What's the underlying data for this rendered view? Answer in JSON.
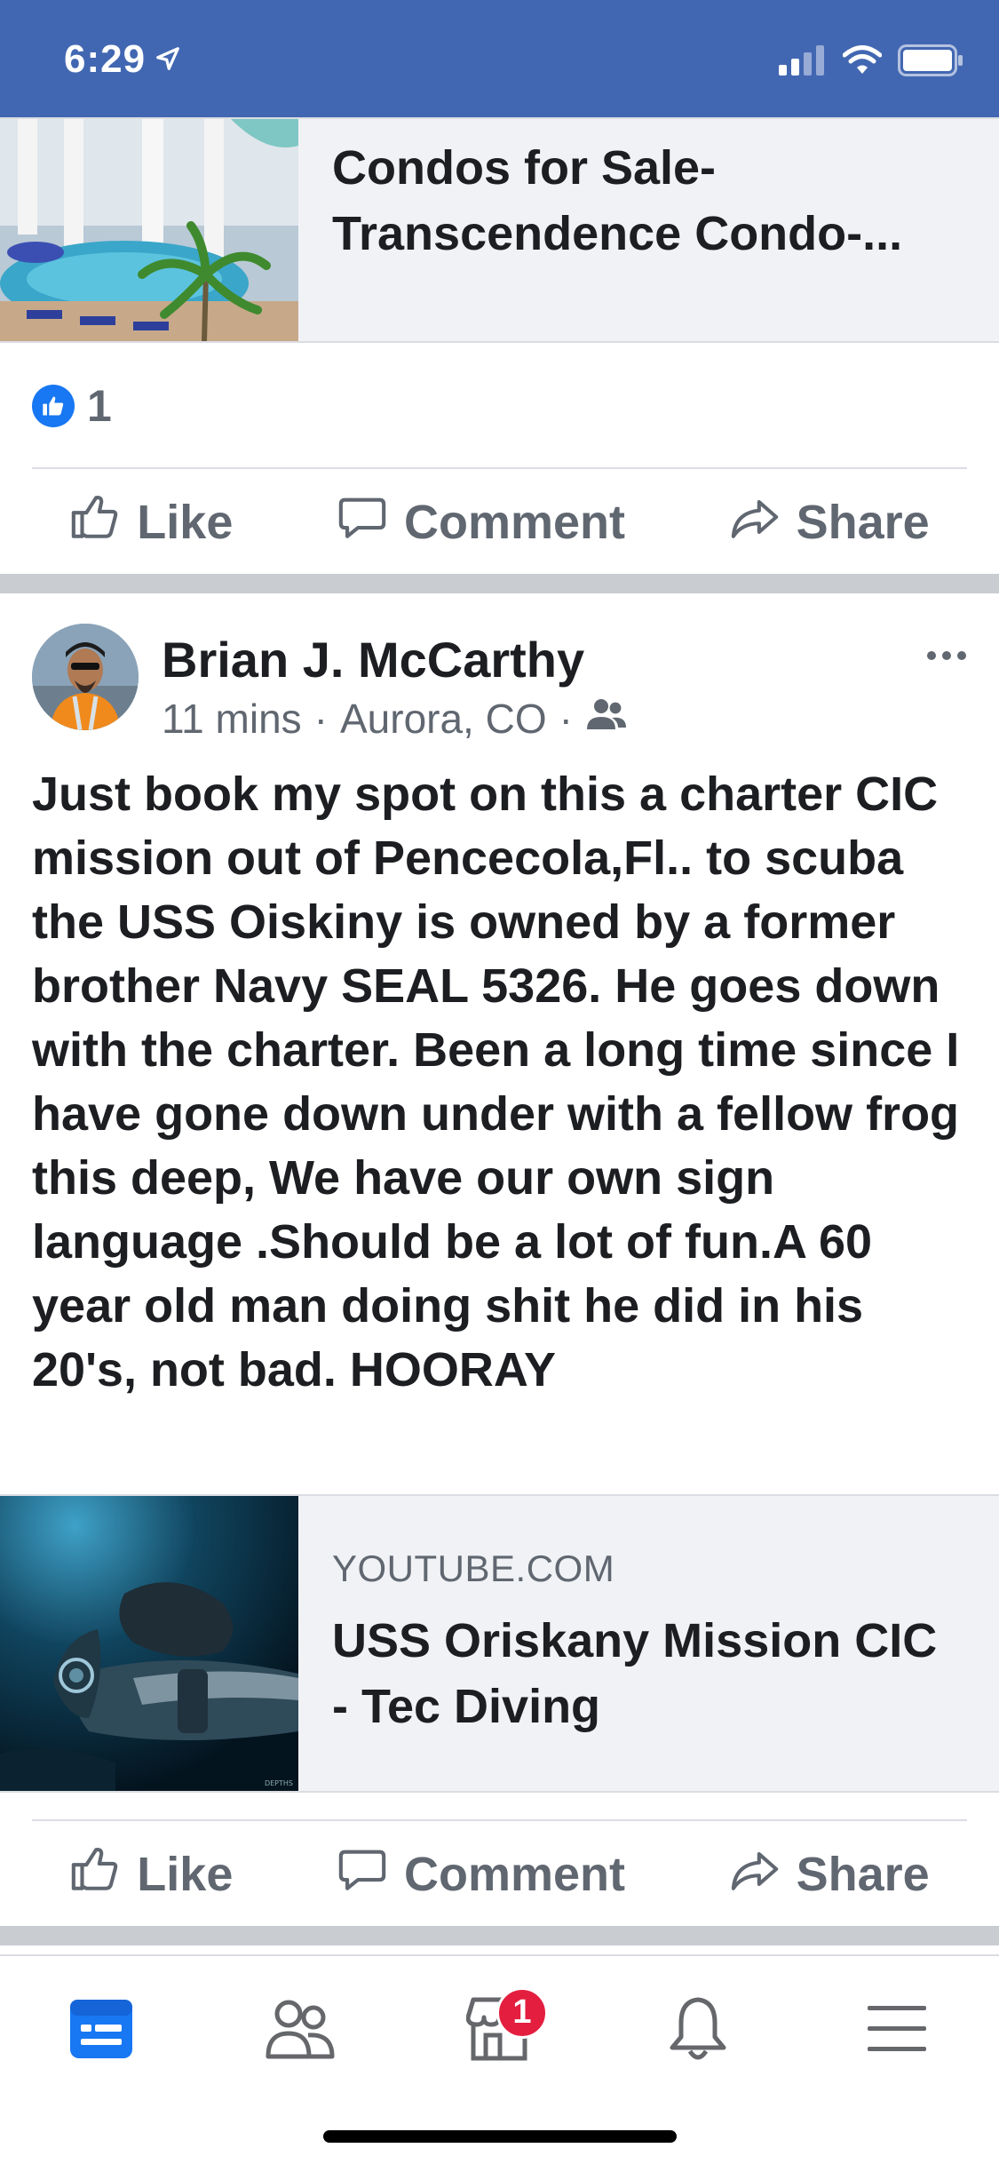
{
  "status_bar": {
    "time": "6:29",
    "icons": [
      "location-arrow-icon",
      "signal-icon",
      "wifi-icon",
      "battery-icon"
    ],
    "color": "#4267b2"
  },
  "prev_post": {
    "link_card": {
      "title": "Condos for Sale-Transcendence Condo-..."
    },
    "reactions": {
      "count": "1"
    }
  },
  "actions": {
    "like": "Like",
    "comment": "Comment",
    "share": "Share"
  },
  "post": {
    "author": "Brian J. McCarthy",
    "time": "11 mins",
    "location": "Aurora, CO",
    "audience_icon": "friends-icon",
    "text": "Just book my spot on this a charter CIC mission out of Pencecola,Fl.. to scuba the USS Oiskiny is owned by a former brother Navy SEAL 5326. He goes down with the charter. Been a long time since I have gone down under with a fellow frog this deep, We have our own sign language .Should be a lot of fun.A 60 year old man doing shit he did in his 20's, not bad. HOORAY",
    "link_card": {
      "domain": "YOUTUBE.COM",
      "title": "USS Oriskany Mission CIC - Tec Diving",
      "thumb_caption": "DEPTHS"
    }
  },
  "tab_bar": {
    "tabs": [
      "news-feed-icon",
      "friends-icon",
      "marketplace-icon",
      "notifications-icon",
      "menu-icon"
    ],
    "marketplace_badge": "1",
    "active_color": "#1877f2"
  }
}
